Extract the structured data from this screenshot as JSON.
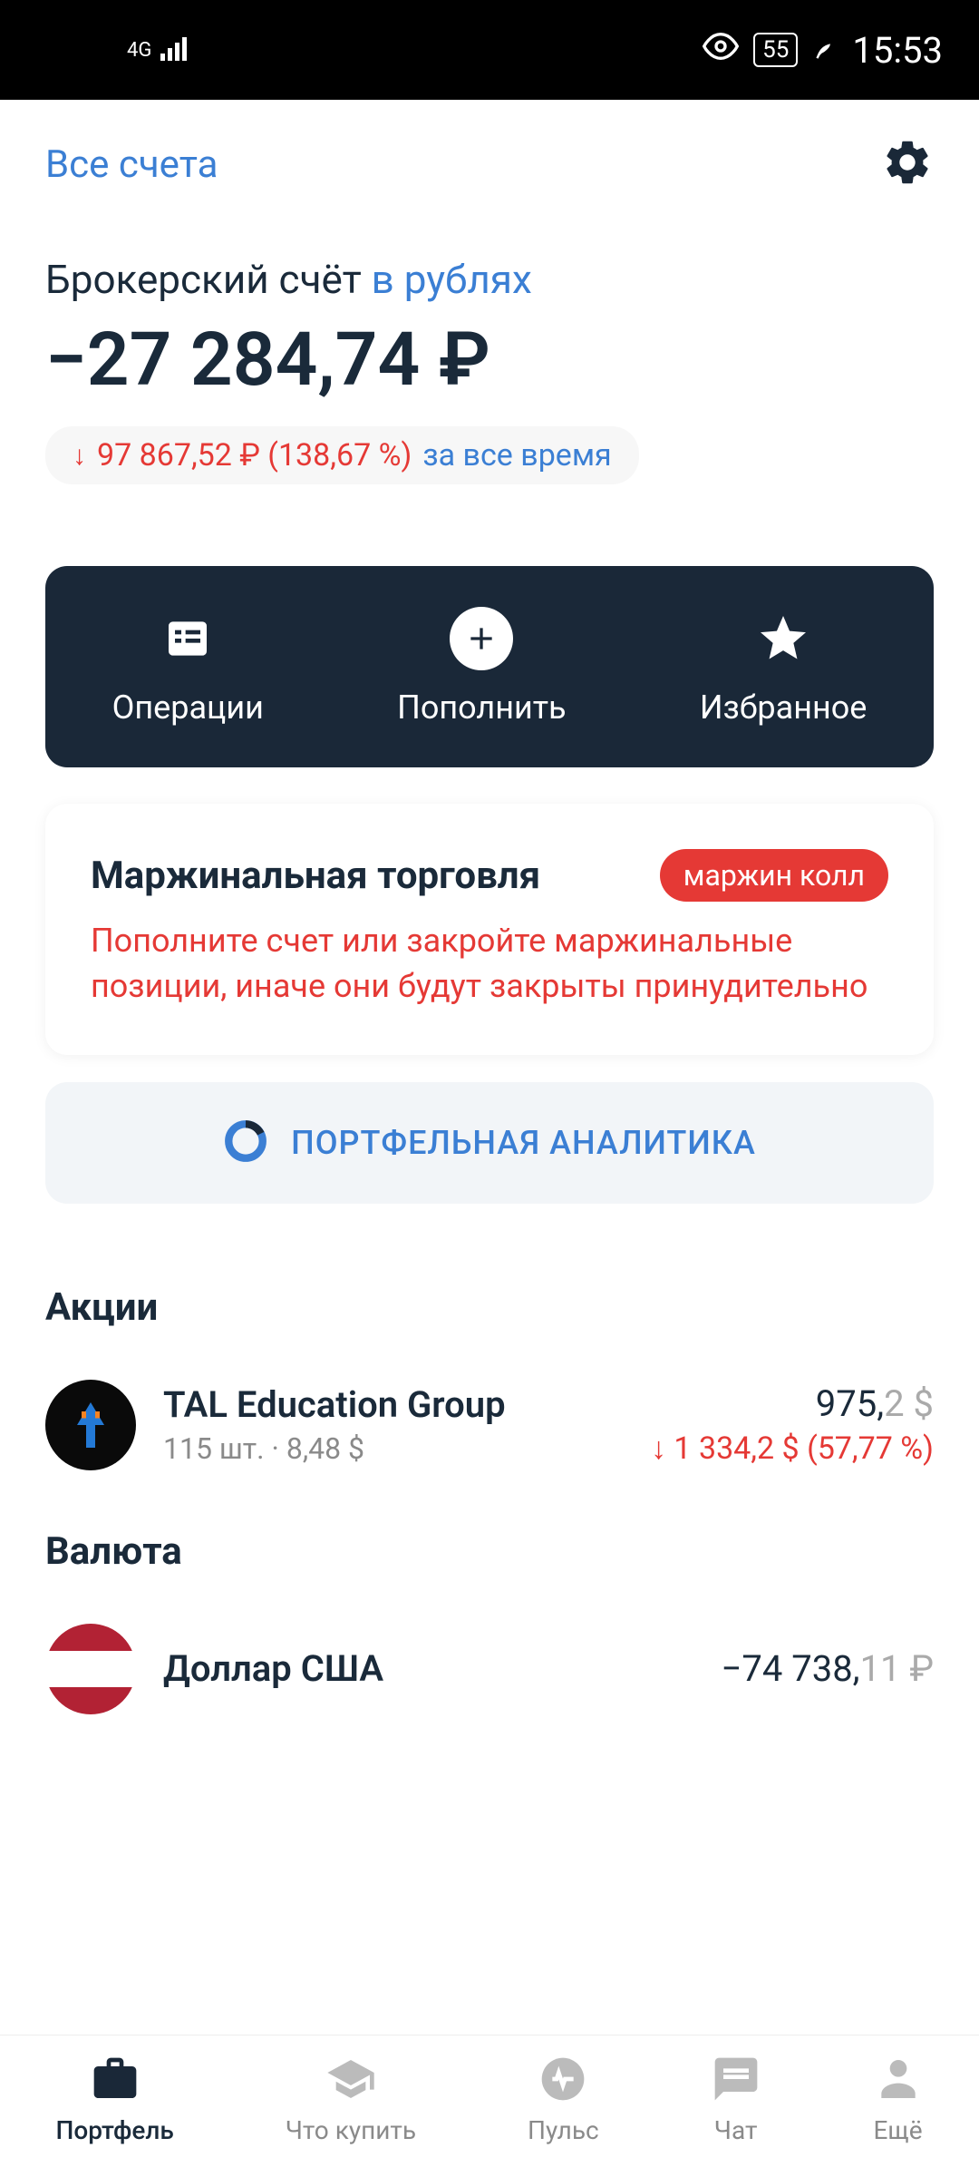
{
  "status": {
    "signal": "4G",
    "battery": "55",
    "time": "15:53"
  },
  "header": {
    "all_accounts": "Все счета"
  },
  "account": {
    "title": "Брокерский счёт ",
    "currency_link": "в рублях",
    "balance": "−27 284,74 ₽",
    "change_value": "97 867,52 ₽ (138,67 %)",
    "period": "за все время"
  },
  "actions": {
    "operations": "Операции",
    "deposit": "Пополнить",
    "favorites": "Избранное"
  },
  "margin": {
    "title": "Маржинальная торговля",
    "badge": "маржин колл",
    "text": "Пополните счет или закройте маржинальные позиции, иначе они будут закрыты принудительно"
  },
  "analytics": {
    "label": "ПОРТФЕЛЬНАЯ АНАЛИТИКА"
  },
  "sections": {
    "stocks": "Акции",
    "currency": "Валюта"
  },
  "stocks": [
    {
      "name": "TAL Education Group",
      "sub": "115 шт. · 8,48 $",
      "value_main": "975,",
      "value_dec": "2 $",
      "change": "1 334,2 $ (57,77 %)"
    }
  ],
  "currencies": [
    {
      "name": "Доллар США",
      "value_main": "−74 738,",
      "value_dec": "11 ₽"
    }
  ],
  "nav": {
    "portfolio": "Портфель",
    "buy": "Что купить",
    "pulse": "Пульс",
    "chat": "Чат",
    "more": "Ещё"
  }
}
